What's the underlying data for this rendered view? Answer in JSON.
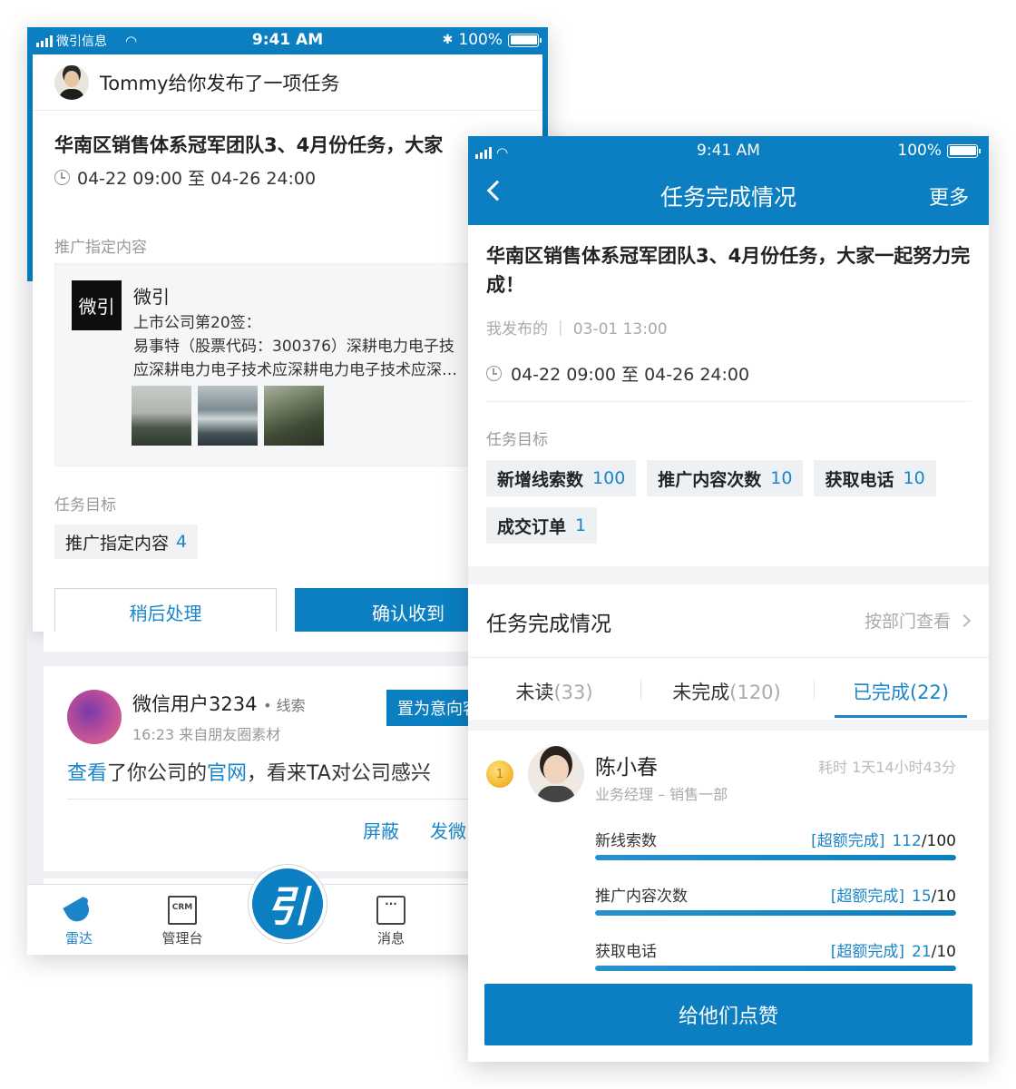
{
  "back_phone": {
    "status_bar": {
      "carrier": "微引信息",
      "time": "9:41 AM",
      "battery": "100%"
    },
    "notification": {
      "text": "Tommy给你发布了一项任务"
    },
    "task": {
      "title": "华南区销售体系冠军团队3、4月份任务，大家",
      "time_range": "04-22 09:00 至 04-26 24:00",
      "promo_section_label": "推广指定内容",
      "promo": {
        "logo_text": "微引",
        "name": "微引",
        "line1": "上市公司第20签：",
        "line2": "易事特（股票代码：300376）深耕电力电子技",
        "line3": "应深耕电力电子技术应深耕电力电子技术应深…"
      },
      "goal_section_label": "任务目标",
      "goal": {
        "label": "推广指定内容",
        "value": "4"
      },
      "btn_later": "稍后处理",
      "btn_confirm": "确认收到"
    },
    "lead": {
      "name": "微信用户3234",
      "tag": "• 线索",
      "meta": "16:23  来自朋友圈素材",
      "action_button": "置为意向客",
      "text_prefix": "查看",
      "text_mid": "了你公司的",
      "text_link": "官网",
      "text_suffix": "，看来TA对公司感兴",
      "action_block": "屏蔽",
      "action_wechat": "发微"
    },
    "tabbar": {
      "radar": "雷达",
      "console": "管理台",
      "center": "引",
      "messages": "消息",
      "crm_icon_text": "CRM",
      "msg_icon_text": "···"
    }
  },
  "front_phone": {
    "status_bar": {
      "time": "9:41 AM",
      "battery": "100%"
    },
    "header": {
      "title": "任务完成情况",
      "more": "更多"
    },
    "task": {
      "title": "华南区销售体系冠军团队3、4月份任务，大家一起努力完成！",
      "meta": "我发布的 ｜ 03-01 13:00",
      "time_range": "04-22 09:00 至 04-26 24:00",
      "goal_label": "任务目标",
      "goals": [
        {
          "label": "新增线索数",
          "value": "100"
        },
        {
          "label": "推广内容次数",
          "value": "10"
        },
        {
          "label": "获取电话",
          "value": "10"
        },
        {
          "label": "成交订单",
          "value": "1"
        }
      ]
    },
    "completion": {
      "title": "任务完成情况",
      "by_dept": "按部门查看",
      "tabs": [
        {
          "label": "未读",
          "count": "(33)"
        },
        {
          "label": "未完成",
          "count": "(120)"
        },
        {
          "label": "已完成",
          "count": "(22)"
        }
      ],
      "person": {
        "rank": "1",
        "name": "陈小春",
        "role": "业务经理 – 销售一部",
        "duration": "耗时 1天14小时43分",
        "metrics": [
          {
            "label": "新线索数",
            "tag": "[超额完成]",
            "achieved": "112",
            "target": "/100",
            "fill": 1.0
          },
          {
            "label": "推广内容次数",
            "tag": "[超额完成]",
            "achieved": "15",
            "target": "/10",
            "fill": 1.0
          },
          {
            "label": "获取电话",
            "tag": "[超额完成]",
            "achieved": "21",
            "target": "/10",
            "fill": 1.0
          }
        ]
      }
    },
    "like_button": "给他们点赞"
  },
  "colors": {
    "primary": "#0b7fc1",
    "accent_text": "#1a85c8",
    "chip_bg": "#eef1f4",
    "page_gray": "#f2f4f6"
  }
}
